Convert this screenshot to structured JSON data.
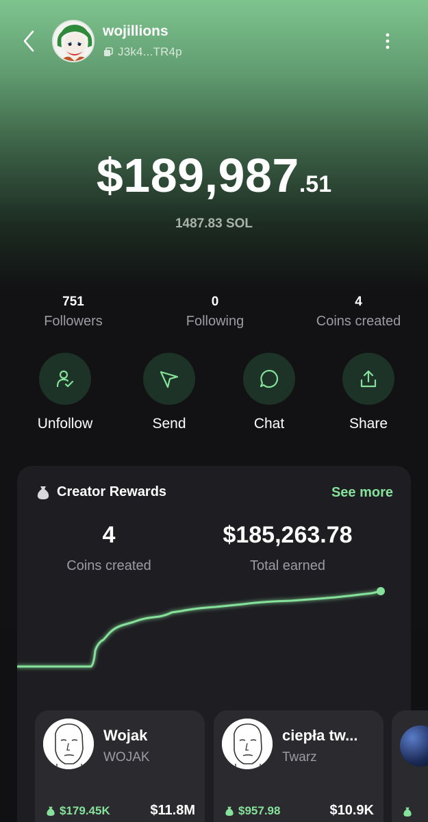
{
  "profile": {
    "username": "wojillions",
    "address": "J3k4...TR4p"
  },
  "balance": {
    "main": "$189,987",
    "cents": ".51",
    "sol": "1487.83 SOL"
  },
  "stats": [
    {
      "value": "751",
      "label": "Followers"
    },
    {
      "value": "0",
      "label": "Following"
    },
    {
      "value": "4",
      "label": "Coins created"
    }
  ],
  "actions": [
    {
      "label": "Unfollow",
      "icon": "user-check-icon"
    },
    {
      "label": "Send",
      "icon": "send-icon"
    },
    {
      "label": "Chat",
      "icon": "chat-bubble-icon"
    },
    {
      "label": "Share",
      "icon": "share-icon"
    }
  ],
  "rewards": {
    "title": "Creator Rewards",
    "see_more": "See more",
    "coins_created_value": "4",
    "coins_created_label": "Coins created",
    "total_earned_value": "$185,263.78",
    "total_earned_label": "Total earned",
    "accent_color": "#86e29b"
  },
  "coins": [
    {
      "name": "Wojak",
      "ticker": "WOJAK",
      "earned": "$179.45K",
      "market_cap": "$11.8M"
    },
    {
      "name": "ciepła tw...",
      "ticker": "Twarz",
      "earned": "$957.98",
      "market_cap": "$10.9K"
    }
  ]
}
